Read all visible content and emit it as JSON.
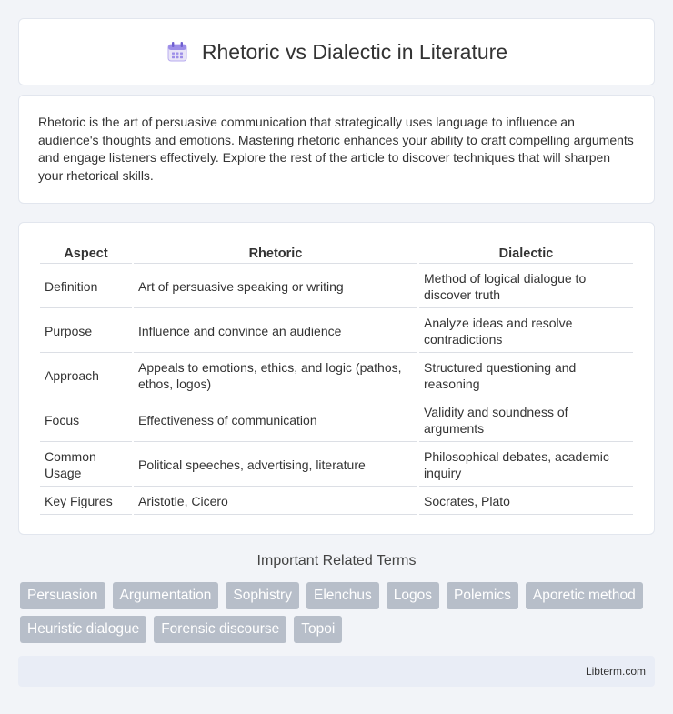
{
  "header": {
    "title": "Rhetoric vs Dialectic in Literature",
    "icon": "calendar-icon"
  },
  "intro": {
    "text": "Rhetoric is the art of persuasive communication that strategically uses language to influence an audience's thoughts and emotions. Mastering rhetoric enhances your ability to craft compelling arguments and engage listeners effectively. Explore the rest of the article to discover techniques that will sharpen your rhetorical skills."
  },
  "table": {
    "headers": [
      "Aspect",
      "Rhetoric",
      "Dialectic"
    ],
    "rows": [
      [
        "Definition",
        "Art of persuasive speaking or writing",
        "Method of logical dialogue to discover truth"
      ],
      [
        "Purpose",
        "Influence and convince an audience",
        "Analyze ideas and resolve contradictions"
      ],
      [
        "Approach",
        "Appeals to emotions, ethics, and logic (pathos, ethos, logos)",
        "Structured questioning and reasoning"
      ],
      [
        "Focus",
        "Effectiveness of communication",
        "Validity and soundness of arguments"
      ],
      [
        "Common Usage",
        "Political speeches, advertising, literature",
        "Philosophical debates, academic inquiry"
      ],
      [
        "Key Figures",
        "Aristotle, Cicero",
        "Socrates, Plato"
      ]
    ]
  },
  "related": {
    "title": "Important Related Terms",
    "tags": [
      "Persuasion",
      "Argumentation",
      "Sophistry",
      "Elenchus",
      "Logos",
      "Polemics",
      "Aporetic method",
      "Heuristic dialogue",
      "Forensic discourse",
      "Topoi"
    ]
  },
  "footer": {
    "text": "Libterm.com"
  },
  "colors": {
    "tag_bg": "#b7bec9",
    "page_bg": "#f2f4f8",
    "footer_bg": "#e9edf6"
  }
}
